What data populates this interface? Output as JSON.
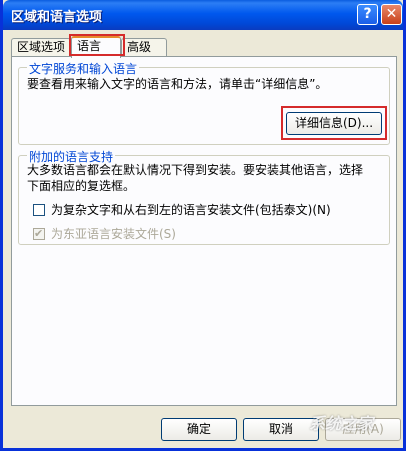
{
  "window": {
    "title": "区域和语言选项"
  },
  "title_buttons": {
    "help": "?",
    "close": "✕"
  },
  "tabs": [
    {
      "label": "区域选项"
    },
    {
      "label": "语言"
    },
    {
      "label": "高级"
    }
  ],
  "text_services": {
    "title": "文字服务和输入语言",
    "description": "要查看用来输入文字的语言和方法，请单击“详细信息”。",
    "details_button": "详细信息(D)..."
  },
  "supplemental": {
    "title": "附加的语言支持",
    "description_line1": "大多数语言都会在默认情况下得到安装。要安装其他语言，选择",
    "description_line2": "下面相应的复选框。",
    "complex_script_label": "为复杂文字和从右到左的语言安装文件(包括泰文)(N)",
    "complex_script_checked": false,
    "east_asian_label": "为东亚语言安装文件(S)",
    "east_asian_checked": true,
    "east_asian_enabled": false
  },
  "footer": {
    "ok_button": "确定",
    "cancel_button": "取消",
    "apply_button": "应用(A)"
  },
  "watermark": "系统之家"
}
